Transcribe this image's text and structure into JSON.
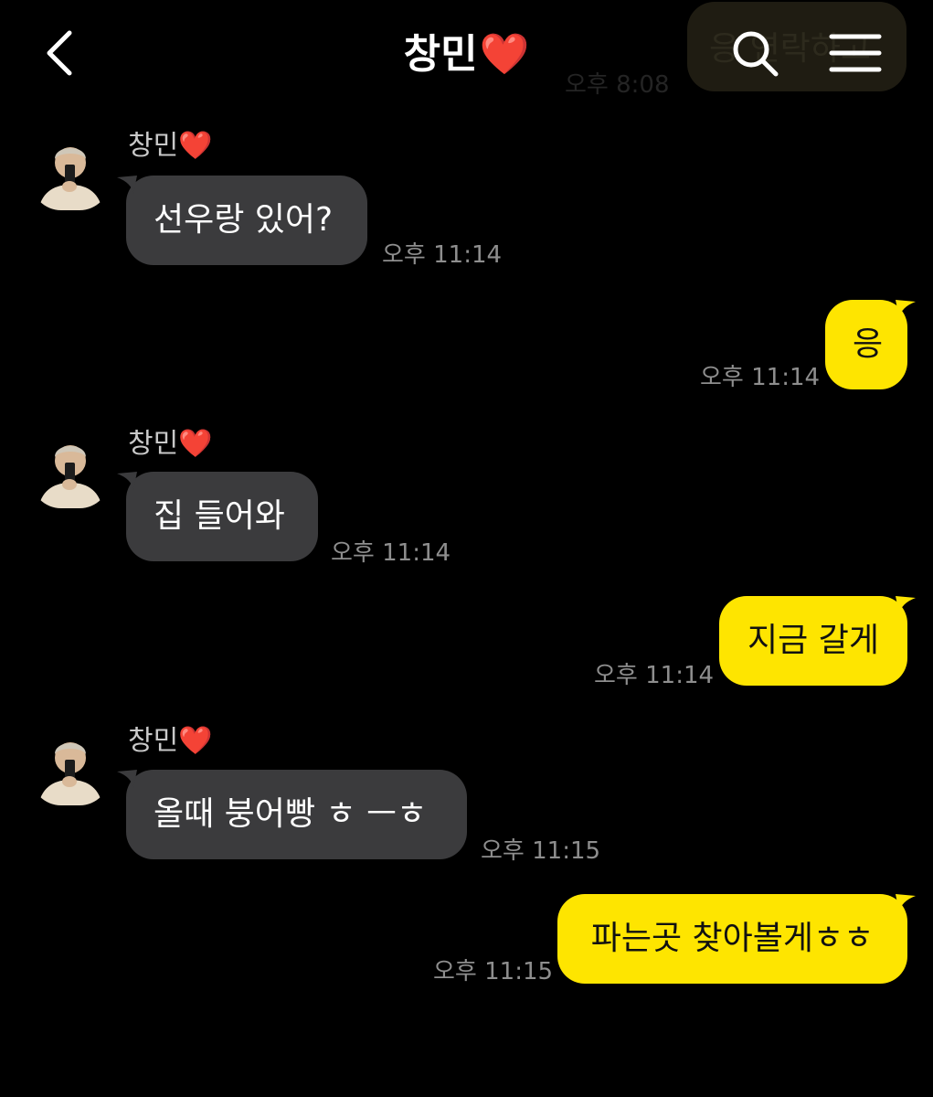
{
  "header": {
    "title": "창민",
    "title_heart": "❤️",
    "back_icon": "chevron-left-icon",
    "search_icon": "search-icon",
    "menu_icon": "hamburger-menu-icon"
  },
  "previous_message": {
    "text": "응 연락하고",
    "time": "오후 8:08"
  },
  "colors": {
    "background": "#000000",
    "incoming_bubble": "#3b3b3d",
    "outgoing_bubble": "#fee500",
    "timestamp": "#8e8e8e",
    "heart": "#e0202a"
  },
  "messages": [
    {
      "direction": "in",
      "sender": "창민",
      "sender_heart": "❤️",
      "text": "선우랑 있어?",
      "time": "오후 11:14"
    },
    {
      "direction": "out",
      "text": "응",
      "time": "오후 11:14"
    },
    {
      "direction": "in",
      "sender": "창민",
      "sender_heart": "❤️",
      "text": "집 들어와",
      "time": "오후 11:14"
    },
    {
      "direction": "out",
      "text": "지금 갈게",
      "time": "오후 11:14"
    },
    {
      "direction": "in",
      "sender": "창민",
      "sender_heart": "❤️",
      "text": "올때 붕어빵 ㅎ ㅡㅎ",
      "time": "오후 11:15"
    },
    {
      "direction": "out",
      "text": "파는곳 찾아볼게ㅎㅎ",
      "time": "오후 11:15"
    }
  ]
}
